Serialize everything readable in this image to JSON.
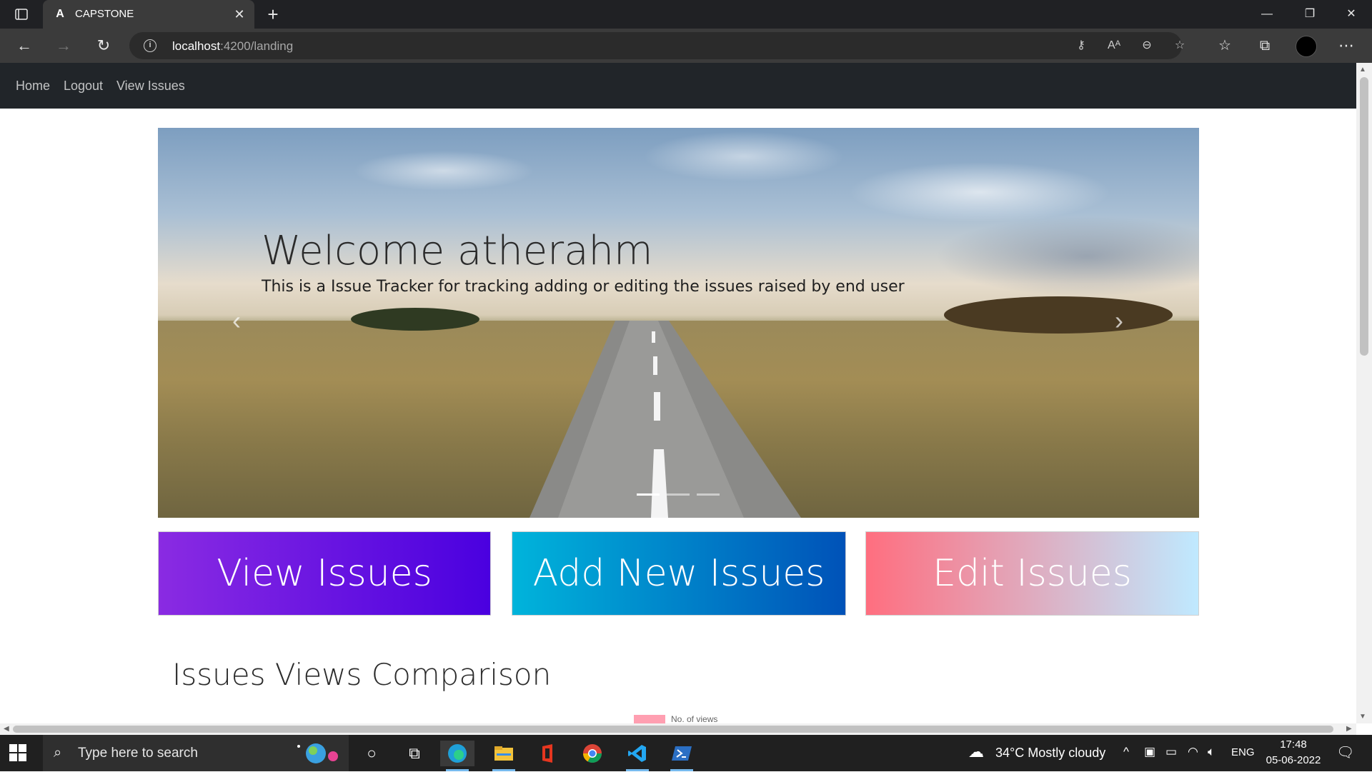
{
  "browser": {
    "tab_title": "CAPSTONE",
    "tab_favicon": "A",
    "url_host": "localhost",
    "url_rest": ":4200/landing"
  },
  "app_nav": {
    "items": [
      "Home",
      "Logout",
      "View Issues"
    ]
  },
  "carousel": {
    "title": "Welcome atherahm",
    "subtitle": "This is a Issue Tracker for tracking adding or editing the issues raised by end user",
    "indicator_count": 3,
    "active_indicator": 0
  },
  "actions": {
    "view": "View Issues",
    "add": "Add New Issues",
    "edit": "Edit Issues"
  },
  "section": {
    "title": "Issues Views Comparison",
    "legend_label": "No. of views",
    "legend_color": "#ff9fb1"
  },
  "taskbar": {
    "search_placeholder": "Type here to search",
    "weather": "34°C  Mostly cloudy",
    "language": "ENG",
    "time": "17:48",
    "date": "05-06-2022"
  },
  "colors": {
    "view_gradient": [
      "#8a2be2",
      "#4a00e0"
    ],
    "add_gradient": [
      "#00b4db",
      "#0052b8"
    ],
    "edit_gradient": [
      "#ff6e7f",
      "#bfe9ff"
    ],
    "navbar": "#212529"
  }
}
